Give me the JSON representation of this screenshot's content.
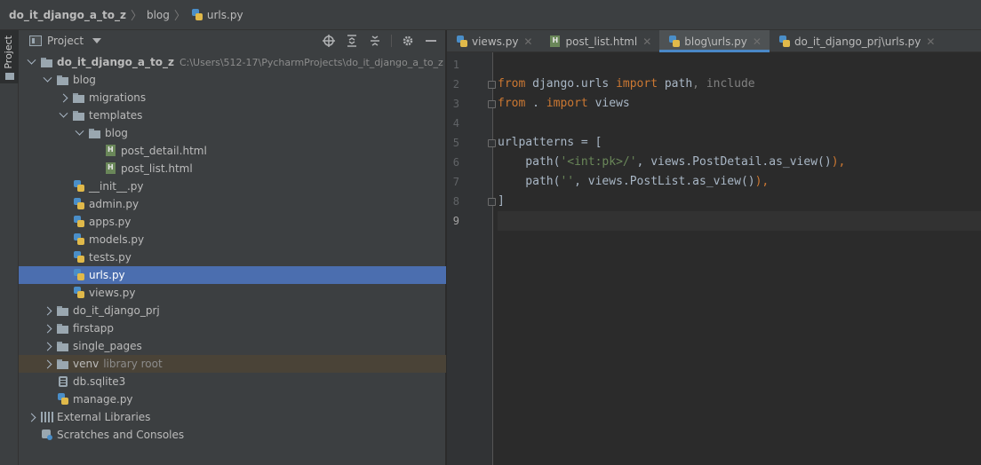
{
  "breadcrumb": [
    "do_it_django_a_to_z",
    "blog",
    "urls.py"
  ],
  "toolstrip": {
    "project_tab": "Project"
  },
  "panel": {
    "title": "Project",
    "tree": [
      {
        "label": "do_it_django_a_to_z",
        "hint": "C:\\Users\\512-17\\PycharmProjects\\do_it_django_a_to_z",
        "icon": "folder-icon",
        "depth": 0,
        "arrow": "open",
        "bold": true
      },
      {
        "label": "blog",
        "icon": "folder-icon",
        "depth": 1,
        "arrow": "open"
      },
      {
        "label": "migrations",
        "icon": "folder-icon",
        "depth": 2,
        "arrow": "closed"
      },
      {
        "label": "templates",
        "icon": "folder-icon",
        "depth": 2,
        "arrow": "open"
      },
      {
        "label": "blog",
        "icon": "folder-icon",
        "depth": 3,
        "arrow": "open"
      },
      {
        "label": "post_detail.html",
        "icon": "html-file-icon",
        "depth": 4,
        "arrow": "none"
      },
      {
        "label": "post_list.html",
        "icon": "html-file-icon",
        "depth": 4,
        "arrow": "none"
      },
      {
        "label": "__init__.py",
        "icon": "python-file-icon",
        "depth": 2,
        "arrow": "none"
      },
      {
        "label": "admin.py",
        "icon": "python-file-icon",
        "depth": 2,
        "arrow": "none"
      },
      {
        "label": "apps.py",
        "icon": "python-file-icon",
        "depth": 2,
        "arrow": "none"
      },
      {
        "label": "models.py",
        "icon": "python-file-icon",
        "depth": 2,
        "arrow": "none"
      },
      {
        "label": "tests.py",
        "icon": "python-file-icon",
        "depth": 2,
        "arrow": "none"
      },
      {
        "label": "urls.py",
        "icon": "python-file-icon",
        "depth": 2,
        "arrow": "none",
        "selected": true
      },
      {
        "label": "views.py",
        "icon": "python-file-icon",
        "depth": 2,
        "arrow": "none"
      },
      {
        "label": "do_it_django_prj",
        "icon": "folder-icon",
        "depth": 1,
        "arrow": "closed"
      },
      {
        "label": "firstapp",
        "icon": "folder-icon",
        "depth": 1,
        "arrow": "closed"
      },
      {
        "label": "single_pages",
        "icon": "folder-icon",
        "depth": 1,
        "arrow": "closed"
      },
      {
        "label": "venv",
        "hint": "library root",
        "icon": "folder-icon",
        "depth": 1,
        "arrow": "closed",
        "excluded": true
      },
      {
        "label": "db.sqlite3",
        "icon": "database-icon",
        "depth": 1,
        "arrow": "none"
      },
      {
        "label": "manage.py",
        "icon": "python-file-icon",
        "depth": 1,
        "arrow": "none"
      },
      {
        "label": "External Libraries",
        "icon": "library-icon",
        "depth": 0,
        "arrow": "closed"
      },
      {
        "label": "Scratches and Consoles",
        "icon": "scratch-icon",
        "depth": 0,
        "arrow": "none"
      }
    ]
  },
  "editor": {
    "tabs": [
      {
        "label": "views.py",
        "icon": "python-file-icon",
        "active": false
      },
      {
        "label": "post_list.html",
        "icon": "html-file-icon",
        "active": false
      },
      {
        "label": "blog\\urls.py",
        "icon": "python-file-icon",
        "active": true
      },
      {
        "label": "do_it_django_prj\\urls.py",
        "icon": "python-file-icon",
        "active": false
      }
    ],
    "line_numbers": [
      "1",
      "2",
      "3",
      "4",
      "5",
      "6",
      "7",
      "8",
      "9"
    ],
    "current_line": 9,
    "code": [
      [],
      [
        {
          "t": "from",
          "c": "kw"
        },
        {
          "t": " django.urls ",
          "c": ""
        },
        {
          "t": "import",
          "c": "kw"
        },
        {
          "t": " path",
          "c": ""
        },
        {
          "t": ", include",
          "c": "dim"
        }
      ],
      [
        {
          "t": "from",
          "c": "kw"
        },
        {
          "t": " . ",
          "c": ""
        },
        {
          "t": "import",
          "c": "kw"
        },
        {
          "t": " views",
          "c": ""
        }
      ],
      [],
      [
        {
          "t": "urlpatterns = [",
          "c": ""
        }
      ],
      [
        {
          "t": "    path(",
          "c": ""
        },
        {
          "t": "'<int:pk>/'",
          "c": "str"
        },
        {
          "t": ", views.PostDetail.as_view()",
          "c": ""
        },
        {
          "t": "),",
          "c": "kw"
        }
      ],
      [
        {
          "t": "    path(",
          "c": ""
        },
        {
          "t": "''",
          "c": "str"
        },
        {
          "t": ", views.PostList.as_view()",
          "c": ""
        },
        {
          "t": "),",
          "c": "kw"
        }
      ],
      [
        {
          "t": "]",
          "c": ""
        }
      ],
      []
    ]
  }
}
